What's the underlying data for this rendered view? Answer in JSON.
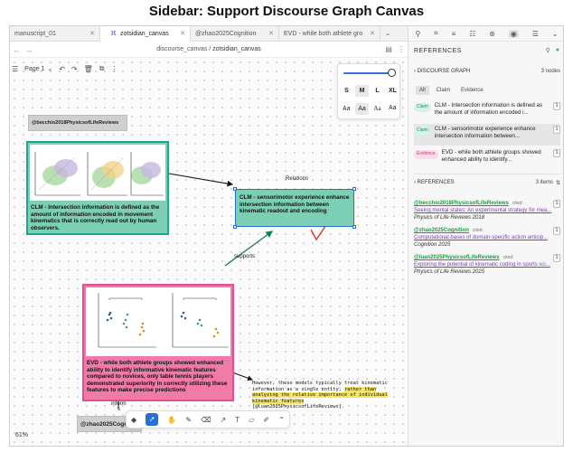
{
  "page_title": "Sidebar: Support Discourse Graph Canvas",
  "tabs": [
    {
      "label": "manuscript_01"
    },
    {
      "label": "zotsidian_canvas"
    },
    {
      "label": "@zhao2025Cognition"
    },
    {
      "label": "EVD - while both athlete gro"
    }
  ],
  "breadcrumb": {
    "folder": "discourse_canvas",
    "separator": "/",
    "file": "zotsidian_canvas"
  },
  "canvas": {
    "page_label": "Page 1",
    "style_panel": {
      "sizes": [
        "S",
        "M",
        "L",
        "XL"
      ],
      "selected_size": "M",
      "fonts": [
        "Aa",
        "Aa",
        "Aa",
        "Aa"
      ]
    },
    "nodes": {
      "becchio_chip": "@becchio2018PhysicsofLifeReviews",
      "clm1_text": "CLM - Intersection information is defined as the amount of information encoded in movement kinematics that is correctly read out by human observers.",
      "clm2_text": "CLM - sensorimotor experience enhance intersection information between kinematic readout and encoding",
      "evd_text": "EVD - while both athlete groups showed enhanced ability to identify informative kinematic features compared to novices, only table tennis players demonstrated superiority in correctly utilizing these features to make precise predictions",
      "zhao_chip": "@zhao2025Cognition"
    },
    "labels": {
      "relations": "Relations",
      "supports": "supports",
      "inform_line1": "inform",
      "inform_line2": "s"
    },
    "note": {
      "line1": "However, these models typically treat kinematic",
      "line2": "information as a single entity, ",
      "line2_hl": "rather than",
      "line3_hl": "analyzing the relative importance of individual",
      "line4_hl": "kinematic features",
      "line5": "[@luan2025PhysicsofLifeReviews]."
    },
    "zoom": "61%"
  },
  "sidebar": {
    "header": "REFERENCES",
    "discourse_graph": {
      "label": "DISCOURSE GRAPH",
      "count": "3 nodes"
    },
    "filters": [
      "All",
      "Claim",
      "Evidence"
    ],
    "selected_filter": "All",
    "nodes": [
      {
        "type": "Claim",
        "text": "CLM - Intersection information is defined as the amount of information encoded i...",
        "count": "1"
      },
      {
        "type": "Claim",
        "text": "CLM - sensorimotor experience enhance intersection information between...",
        "count": "1"
      },
      {
        "type": "Evidence",
        "text": "EVD - while both athlete groups showed enhanced ability to identify...",
        "count": "1"
      }
    ],
    "references": {
      "label": "REFERENCES",
      "count": "3 items"
    },
    "refs": [
      {
        "key": "@becchio2018PhysicsofLifeReviews",
        "cited": "cited:",
        "title": "Seeing mental states: An experimental strategy for mea...",
        "journal": "Physics of Life Reviews 2018",
        "count": "1"
      },
      {
        "key": "@zhao2025Cognition",
        "cited": "cited:",
        "title": "Computational bases of domain-specific action anticip...",
        "journal": "Cognition 2025",
        "count": "1"
      },
      {
        "key": "@luan2025PhysicsofLifeReviews",
        "cited": "cited:",
        "title": "Exploring the potential of kinematic coding in sports sci...",
        "journal": "Physics of Life Reviews 2025",
        "count": "1"
      }
    ]
  }
}
